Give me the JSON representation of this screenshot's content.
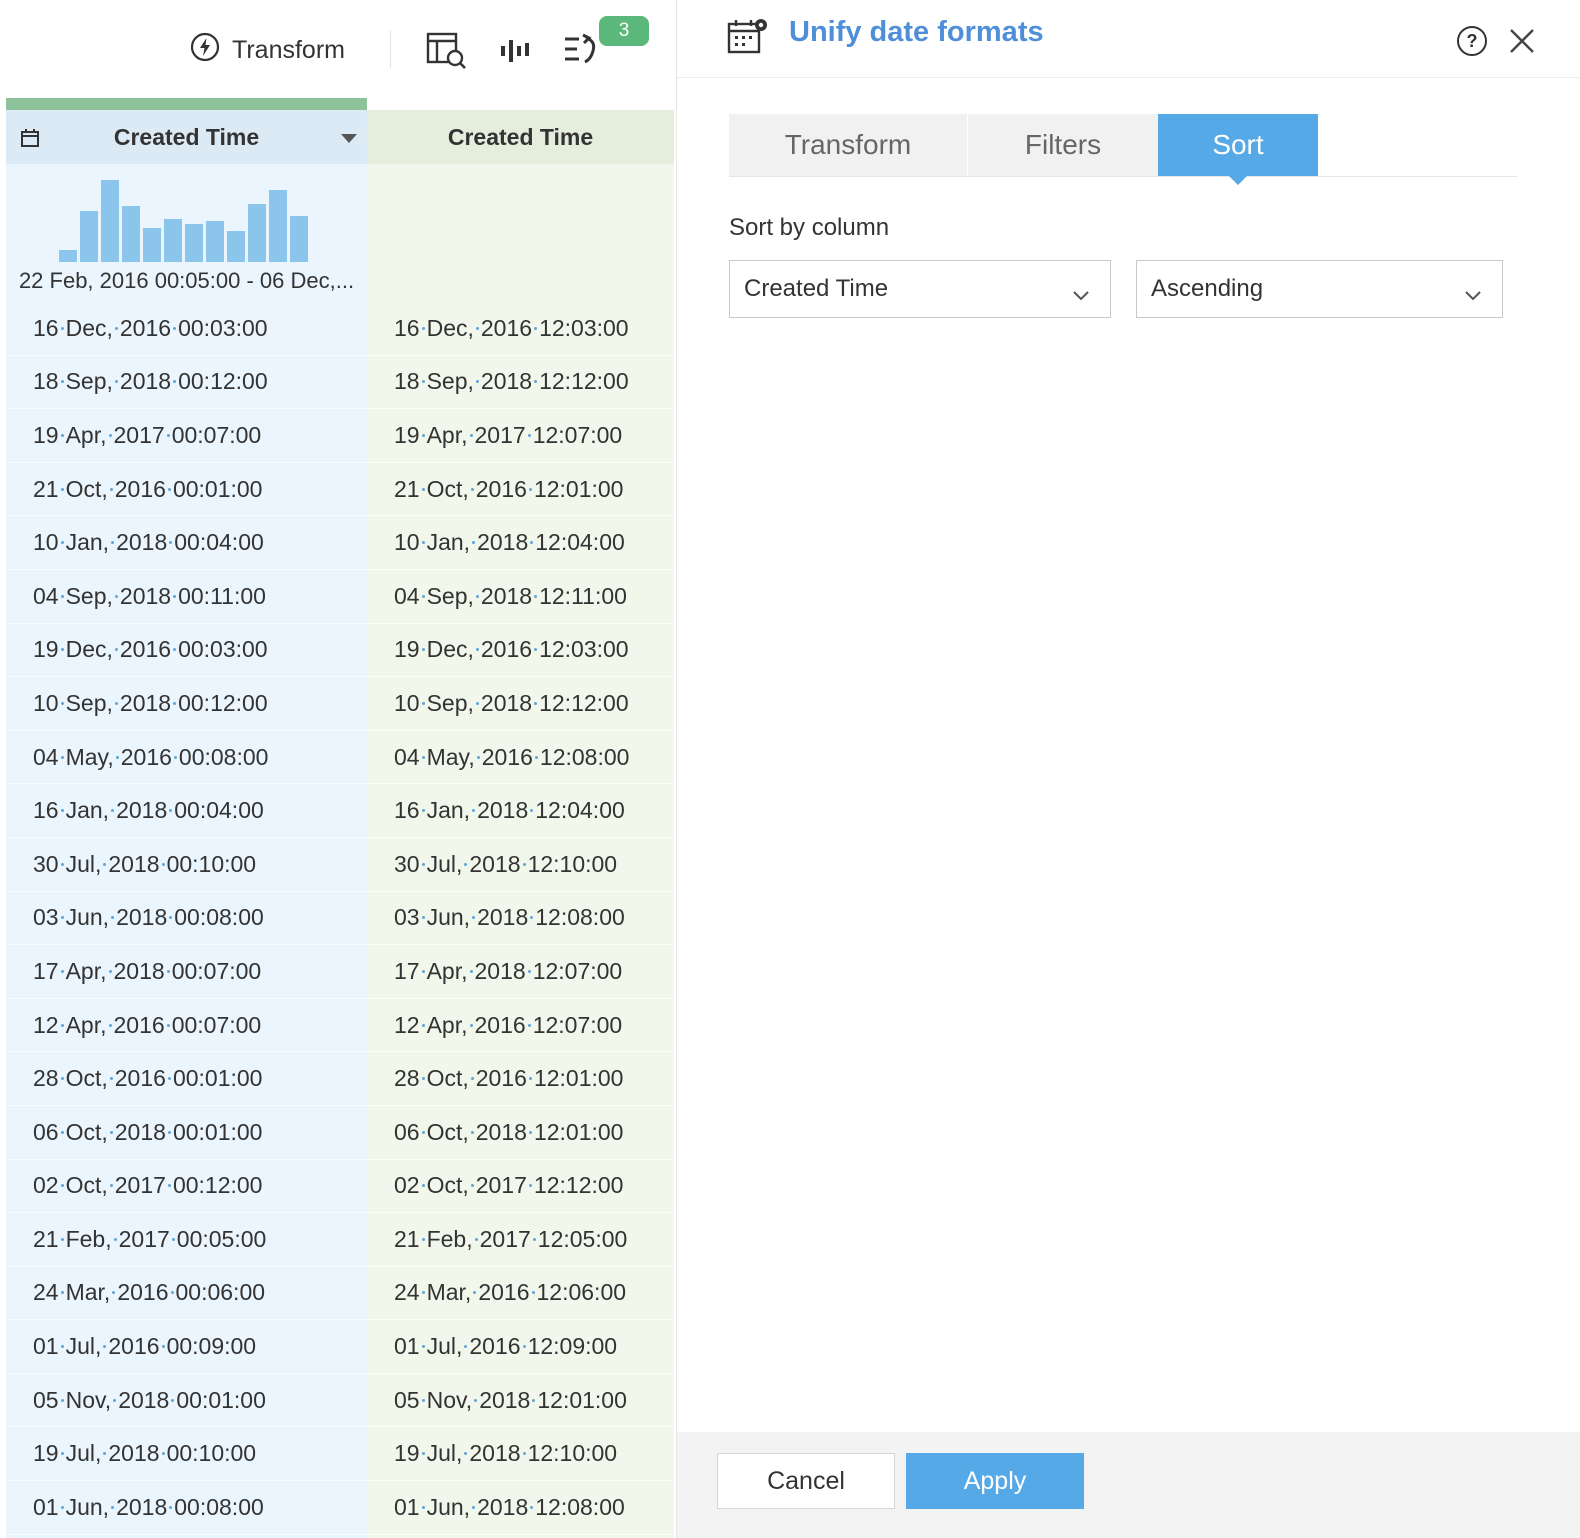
{
  "toolbar": {
    "transform_label": "Transform",
    "badge_count": "3",
    "icons": [
      "lightning-icon",
      "table-search-icon",
      "histogram-icon",
      "steps-icon"
    ]
  },
  "grid": {
    "col1": {
      "header": "Created Time",
      "range": "22 Feb, 2016 00:05:00 - 06 Dec,...",
      "histogram": [
        0.15,
        0.62,
        1.0,
        0.68,
        0.42,
        0.53,
        0.46,
        0.5,
        0.38,
        0.71,
        0.88,
        0.56
      ],
      "rows": [
        [
          "16",
          "Dec,",
          "2016",
          "00:03:00"
        ],
        [
          "18",
          "Sep,",
          "2018",
          "00:12:00"
        ],
        [
          "19",
          "Apr,",
          "2017",
          "00:07:00"
        ],
        [
          "21",
          "Oct,",
          "2016",
          "00:01:00"
        ],
        [
          "10",
          "Jan,",
          "2018",
          "00:04:00"
        ],
        [
          "04",
          "Sep,",
          "2018",
          "00:11:00"
        ],
        [
          "19",
          "Dec,",
          "2016",
          "00:03:00"
        ],
        [
          "10",
          "Sep,",
          "2018",
          "00:12:00"
        ],
        [
          "04",
          "May,",
          "2016",
          "00:08:00"
        ],
        [
          "16",
          "Jan,",
          "2018",
          "00:04:00"
        ],
        [
          "30",
          "Jul,",
          "2018",
          "00:10:00"
        ],
        [
          "03",
          "Jun,",
          "2018",
          "00:08:00"
        ],
        [
          "17",
          "Apr,",
          "2018",
          "00:07:00"
        ],
        [
          "12",
          "Apr,",
          "2016",
          "00:07:00"
        ],
        [
          "28",
          "Oct,",
          "2016",
          "00:01:00"
        ],
        [
          "06",
          "Oct,",
          "2018",
          "00:01:00"
        ],
        [
          "02",
          "Oct,",
          "2017",
          "00:12:00"
        ],
        [
          "21",
          "Feb,",
          "2017",
          "00:05:00"
        ],
        [
          "24",
          "Mar,",
          "2016",
          "00:06:00"
        ],
        [
          "01",
          "Jul,",
          "2016",
          "00:09:00"
        ],
        [
          "05",
          "Nov,",
          "2018",
          "00:01:00"
        ],
        [
          "19",
          "Jul,",
          "2018",
          "00:10:00"
        ],
        [
          "01",
          "Jun,",
          "2018",
          "00:08:00"
        ]
      ]
    },
    "col2": {
      "header": "Created Time",
      "rows": [
        [
          "16",
          "Dec,",
          "2016",
          "12:03:00"
        ],
        [
          "18",
          "Sep,",
          "2018",
          "12:12:00"
        ],
        [
          "19",
          "Apr,",
          "2017",
          "12:07:00"
        ],
        [
          "21",
          "Oct,",
          "2016",
          "12:01:00"
        ],
        [
          "10",
          "Jan,",
          "2018",
          "12:04:00"
        ],
        [
          "04",
          "Sep,",
          "2018",
          "12:11:00"
        ],
        [
          "19",
          "Dec,",
          "2016",
          "12:03:00"
        ],
        [
          "10",
          "Sep,",
          "2018",
          "12:12:00"
        ],
        [
          "04",
          "May,",
          "2016",
          "12:08:00"
        ],
        [
          "16",
          "Jan,",
          "2018",
          "12:04:00"
        ],
        [
          "30",
          "Jul,",
          "2018",
          "12:10:00"
        ],
        [
          "03",
          "Jun,",
          "2018",
          "12:08:00"
        ],
        [
          "17",
          "Apr,",
          "2018",
          "12:07:00"
        ],
        [
          "12",
          "Apr,",
          "2016",
          "12:07:00"
        ],
        [
          "28",
          "Oct,",
          "2016",
          "12:01:00"
        ],
        [
          "06",
          "Oct,",
          "2018",
          "12:01:00"
        ],
        [
          "02",
          "Oct,",
          "2017",
          "12:12:00"
        ],
        [
          "21",
          "Feb,",
          "2017",
          "12:05:00"
        ],
        [
          "24",
          "Mar,",
          "2016",
          "12:06:00"
        ],
        [
          "01",
          "Jul,",
          "2016",
          "12:09:00"
        ],
        [
          "05",
          "Nov,",
          "2018",
          "12:01:00"
        ],
        [
          "19",
          "Jul,",
          "2018",
          "12:10:00"
        ],
        [
          "01",
          "Jun,",
          "2018",
          "12:08:00"
        ]
      ]
    }
  },
  "panel": {
    "title": "Unify date formats",
    "tabs": [
      {
        "label": "Transform",
        "active": false
      },
      {
        "label": "Filters",
        "active": false
      },
      {
        "label": "Sort",
        "active": true
      }
    ],
    "sort_label": "Sort by column",
    "column_select": "Created Time",
    "order_select": "Ascending",
    "cancel_label": "Cancel",
    "apply_label": "Apply",
    "accent_color": "#55a9e6"
  }
}
